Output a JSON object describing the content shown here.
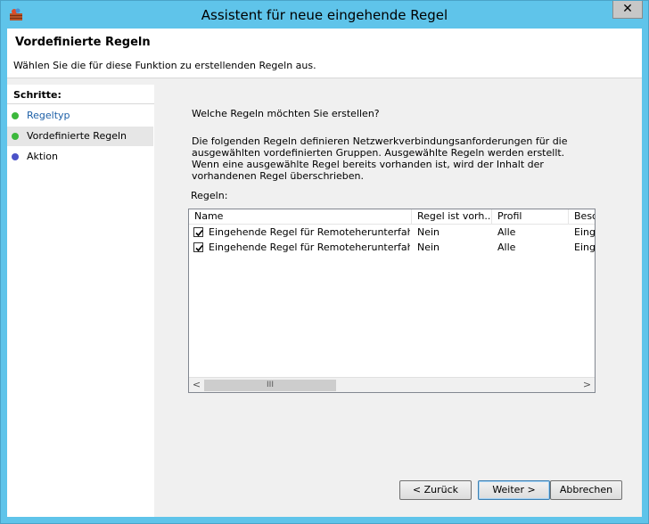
{
  "window": {
    "title": "Assistent für neue eingehende Regel"
  },
  "header": {
    "title": "Vordefinierte Regeln",
    "description": "Wählen Sie die für diese Funktion zu erstellenden Regeln aus."
  },
  "sidebar": {
    "heading": "Schritte:",
    "steps": [
      {
        "label": "Regeltyp",
        "dot_color": "#3cb83c",
        "state": "done"
      },
      {
        "label": "Vordefinierte Regeln",
        "dot_color": "#3cb83c",
        "state": "current"
      },
      {
        "label": "Aktion",
        "dot_color": "#4b52c8",
        "state": "pending"
      }
    ]
  },
  "main": {
    "question": "Welche Regeln möchten Sie erstellen?",
    "paragraph": "Die folgenden Regeln definieren Netzwerkverbindungsanforderungen für die ausgewählten vordefinierten Gruppen. Ausgewählte Regeln werden erstellt. Wenn eine ausgewählte Regel bereits vorhanden ist, wird der Inhalt der vorhandenen Regel überschrieben.",
    "rules_label": "Regeln:"
  },
  "rules_table": {
    "columns": [
      "Name",
      "Regel ist vorh...",
      "Profil",
      "Besc"
    ],
    "rows": [
      {
        "checked": true,
        "name": "Eingehende Regel für Remoteherunterfahren ...",
        "exists": "Nein",
        "profile": "Alle",
        "desc": "Einge"
      },
      {
        "checked": true,
        "name": "Eingehende Regel für Remoteherunterfahren ...",
        "exists": "Nein",
        "profile": "Alle",
        "desc": "Einge"
      }
    ],
    "scroll_thumb_glyph": "III"
  },
  "buttons": {
    "back": "< Zurück",
    "next": "Weiter >",
    "cancel": "Abbrechen"
  },
  "icons": {
    "app": "wizard-firewall-icon",
    "close": "close-icon"
  }
}
